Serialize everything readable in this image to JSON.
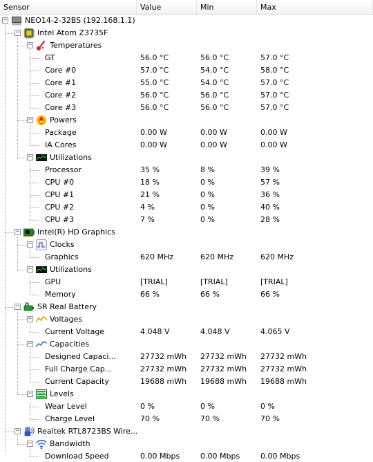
{
  "columns": {
    "sensor": "Sensor",
    "value": "Value",
    "min": "Min",
    "max": "Max"
  },
  "tree": [
    {
      "kind": "group",
      "depth": 0,
      "icon": "computer-icon",
      "label": "NEO14-2-32BS (192.168.1.1)",
      "expanded": true
    },
    {
      "kind": "group",
      "depth": 1,
      "icon": "cpu-chip-icon",
      "label": "Intel Atom Z3735F",
      "expanded": true
    },
    {
      "kind": "group",
      "depth": 2,
      "icon": "thermometer-icon",
      "label": "Temperatures",
      "expanded": true
    },
    {
      "kind": "sensor",
      "depth": 3,
      "label": "GT",
      "value": "56.0 °C",
      "min": "56.0 °C",
      "max": "57.0 °C"
    },
    {
      "kind": "sensor",
      "depth": 3,
      "label": "Core #0",
      "value": "57.0 °C",
      "min": "54.0 °C",
      "max": "58.0 °C"
    },
    {
      "kind": "sensor",
      "depth": 3,
      "label": "Core #1",
      "value": "55.0 °C",
      "min": "54.0 °C",
      "max": "57.0 °C"
    },
    {
      "kind": "sensor",
      "depth": 3,
      "label": "Core #2",
      "value": "56.0 °C",
      "min": "56.0 °C",
      "max": "57.0 °C"
    },
    {
      "kind": "sensor",
      "depth": 3,
      "label": "Core #3",
      "value": "56.0 °C",
      "min": "56.0 °C",
      "max": "57.0 °C"
    },
    {
      "kind": "group",
      "depth": 2,
      "icon": "fire-icon",
      "label": "Powers",
      "expanded": true
    },
    {
      "kind": "sensor",
      "depth": 3,
      "label": "Package",
      "value": "0.00 W",
      "min": "0.00 W",
      "max": "0.00 W"
    },
    {
      "kind": "sensor",
      "depth": 3,
      "label": "IA Cores",
      "value": "0.00 W",
      "min": "0.00 W",
      "max": "0.00 W"
    },
    {
      "kind": "group",
      "depth": 2,
      "icon": "utilization-graph-icon",
      "label": "Utilizations",
      "expanded": true
    },
    {
      "kind": "sensor",
      "depth": 3,
      "label": "Processor",
      "value": "35 %",
      "min": "8 %",
      "max": "39 %"
    },
    {
      "kind": "sensor",
      "depth": 3,
      "label": "CPU #0",
      "value": "18 %",
      "min": "0 %",
      "max": "57 %"
    },
    {
      "kind": "sensor",
      "depth": 3,
      "label": "CPU #1",
      "value": "21 %",
      "min": "0 %",
      "max": "36 %"
    },
    {
      "kind": "sensor",
      "depth": 3,
      "label": "CPU #2",
      "value": "4 %",
      "min": "0 %",
      "max": "40 %"
    },
    {
      "kind": "sensor",
      "depth": 3,
      "label": "CPU #3",
      "value": "7 %",
      "min": "0 %",
      "max": "28 %"
    },
    {
      "kind": "group",
      "depth": 1,
      "icon": "graphics-card-icon",
      "label": "Intel(R) HD Graphics",
      "expanded": true
    },
    {
      "kind": "group",
      "depth": 2,
      "icon": "clock-signal-icon",
      "label": "Clocks",
      "expanded": true
    },
    {
      "kind": "sensor",
      "depth": 3,
      "label": "Graphics",
      "value": "620 MHz",
      "min": "620 MHz",
      "max": "620 MHz"
    },
    {
      "kind": "group",
      "depth": 2,
      "icon": "utilization-graph-icon",
      "label": "Utilizations",
      "expanded": true
    },
    {
      "kind": "sensor",
      "depth": 3,
      "label": "GPU",
      "value": "[TRIAL]",
      "min": "[TRIAL]",
      "max": "[TRIAL]"
    },
    {
      "kind": "sensor",
      "depth": 3,
      "label": "Memory",
      "value": "66 %",
      "min": "66 %",
      "max": "66 %"
    },
    {
      "kind": "group",
      "depth": 1,
      "icon": "battery-icon",
      "label": "SR Real Battery",
      "expanded": true
    },
    {
      "kind": "group",
      "depth": 2,
      "icon": "voltage-wave-icon",
      "label": "Voltages",
      "expanded": true
    },
    {
      "kind": "sensor",
      "depth": 3,
      "label": "Current Voltage",
      "value": "4.048 V",
      "min": "4.048 V",
      "max": "4.065 V"
    },
    {
      "kind": "group",
      "depth": 2,
      "icon": "capacity-wave-icon",
      "label": "Capacities",
      "expanded": true
    },
    {
      "kind": "sensor",
      "depth": 3,
      "label": "Designed Capaci...",
      "value": "27732 mWh",
      "min": "27732 mWh",
      "max": "27732 mWh"
    },
    {
      "kind": "sensor",
      "depth": 3,
      "label": "Full Charge Cap...",
      "value": "27732 mWh",
      "min": "27732 mWh",
      "max": "27732 mWh"
    },
    {
      "kind": "sensor",
      "depth": 3,
      "label": "Current Capacity",
      "value": "19688 mWh",
      "min": "19688 mWh",
      "max": "19688 mWh"
    },
    {
      "kind": "group",
      "depth": 2,
      "icon": "levels-icon",
      "label": "Levels",
      "expanded": true
    },
    {
      "kind": "sensor",
      "depth": 3,
      "label": "Wear Level",
      "value": "0 %",
      "min": "0 %",
      "max": "0 %"
    },
    {
      "kind": "sensor",
      "depth": 3,
      "label": "Charge Level",
      "value": "70 %",
      "min": "70 %",
      "max": "70 %"
    },
    {
      "kind": "group",
      "depth": 1,
      "icon": "network-adapter-icon",
      "label": "Realtek RTL8723BS Wire...",
      "expanded": true
    },
    {
      "kind": "group",
      "depth": 2,
      "icon": "wifi-bandwidth-icon",
      "label": "Bandwidth",
      "expanded": true
    },
    {
      "kind": "sensor",
      "depth": 3,
      "label": "Download Speed",
      "value": "0.00 Mbps",
      "min": "0.00 Mbps",
      "max": "0.00 Mbps"
    }
  ]
}
